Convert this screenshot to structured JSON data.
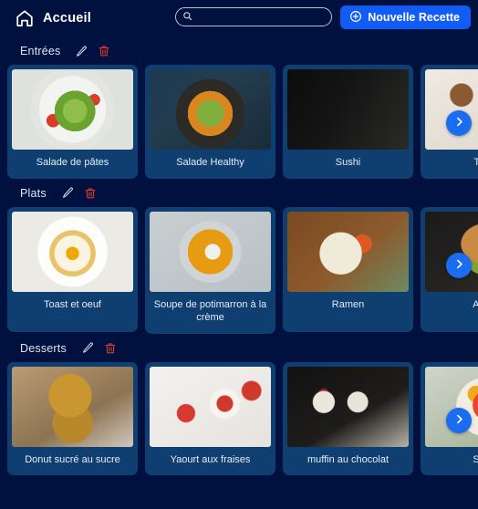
{
  "header": {
    "brand_label": "Accueil",
    "home_icon": "home-icon",
    "search": {
      "icon": "search-icon",
      "value": "",
      "placeholder": ""
    },
    "new_recipe": {
      "label": "Nouvelle Recette",
      "icon": "plus-circle-icon",
      "color": "#115cf5"
    }
  },
  "colors": {
    "page_background": "#00103f",
    "card_background": "#0e3f70",
    "accent_blue": "#1a6cf0",
    "delete_red": "#e03a2f",
    "text": "#e7edf7"
  },
  "sections": [
    {
      "title": "Entrées",
      "edit_icon": "pencil-icon",
      "delete_icon": "trash-icon",
      "next_icon": "chevron-right-icon",
      "cards": [
        {
          "title": "Salade de pâtes"
        },
        {
          "title": "Salade Healthy"
        },
        {
          "title": "Sushi"
        },
        {
          "title": "Toast"
        }
      ]
    },
    {
      "title": "Plats",
      "edit_icon": "pencil-icon",
      "delete_icon": "trash-icon",
      "next_icon": "chevron-right-icon",
      "cards": [
        {
          "title": "Toast et oeuf"
        },
        {
          "title": "Soupe de potimarron à la crème"
        },
        {
          "title": "Ramen"
        },
        {
          "title": "Ameri"
        }
      ]
    },
    {
      "title": "Desserts",
      "edit_icon": "pencil-icon",
      "delete_icon": "trash-icon",
      "next_icon": "chevron-right-icon",
      "cards": [
        {
          "title": "Donut sucré au sucre"
        },
        {
          "title": "Yaourt aux fraises"
        },
        {
          "title": "muffin au chocolat"
        },
        {
          "title": "Salad"
        }
      ]
    }
  ]
}
